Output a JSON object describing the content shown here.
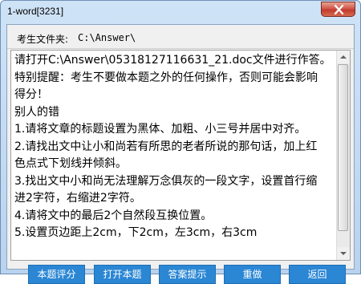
{
  "window": {
    "title": "1-word[3231]"
  },
  "folder": {
    "label": "考生文件夹:",
    "path": "C:\\Answer\\"
  },
  "content": {
    "lines": [
      "请打开C:\\Answer\\05318127116631_21.doc文件进行作答。",
      "特别提醒：考生不要做本题之外的任何操作，否则可能会影响",
      "得分！",
      "别人的错",
      "1.请将文章的标题设置为黑体、加粗、小三号并居中对齐。",
      "2.请找出文中让小和尚若有所思的老者所说的那句话，加上红",
      "色点式下划线并倾斜。",
      "3.找出文中小和尚无法理解万念俱灰的一段文字，设置首行缩",
      "进2字符，右缩进2字符。",
      "4.请将文中的最后2个自然段互换位置。",
      "5.设置页边距上2cm，下2cm，左3cm，右3cm"
    ]
  },
  "buttons": {
    "score": "本题评分",
    "open": "打开本题",
    "hint": "答案提示",
    "redo": "重做",
    "back": "返回"
  },
  "colors": {
    "button_bg": "#2b87d4",
    "close_red": "#c23a2c"
  }
}
